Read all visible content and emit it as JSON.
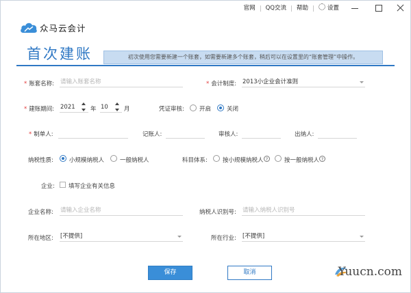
{
  "titlebar": {
    "links": [
      "官网",
      "QQ交流",
      "帮助",
      "设置"
    ]
  },
  "logo": {
    "name": "众马云会计"
  },
  "page": {
    "title": "首次建账",
    "info": "初次使用您需要新建一个账套，如需要新建多个账套，稍后可以在设置里的“账套管理”中操作。"
  },
  "form": {
    "account_name": {
      "label": "账套名称:",
      "placeholder": "请输入账套名称"
    },
    "accounting_system": {
      "label": "会计制度:",
      "value": "2013小企业会计准则"
    },
    "period": {
      "label": "建账期间:",
      "year": "2021",
      "year_unit": "年",
      "month": "10",
      "month_unit": "月"
    },
    "voucher_review": {
      "label": "凭证审核:",
      "options": [
        "开启",
        "关闭"
      ],
      "selected": "关闭"
    },
    "maker": {
      "label": "制单人:"
    },
    "bookkeeper": {
      "label": "记账人:"
    },
    "reviewer": {
      "label": "审核人:"
    },
    "cashier": {
      "label": "出纳人:"
    },
    "tax_nature": {
      "label": "纳税性质:",
      "options": [
        "小规模纳税人",
        "一般纳税人"
      ],
      "selected": "小规模纳税人"
    },
    "subject_system": {
      "label": "科目体系:",
      "options": [
        "按小规模纳税人",
        "按一般纳税人"
      ],
      "selected": ""
    },
    "company": {
      "label": "企业:",
      "checkbox_label": "填写企业有关信息",
      "checked": false
    },
    "company_name": {
      "label": "企业名称:",
      "placeholder": "请输入企业名称"
    },
    "taxpayer_id": {
      "label": "纳税人识别号:",
      "placeholder": "请输入纳税人识别号"
    },
    "region": {
      "label": "所在地区:",
      "value": "[不提供]"
    },
    "industry": {
      "label": "所在行业:",
      "value": "[不提供]"
    }
  },
  "buttons": {
    "save": "保存",
    "cancel": "取消"
  },
  "watermark": {
    "text": "Yuucn.com"
  },
  "colors": {
    "accent": "#2f78c4",
    "info_bg": "#c8dcf1",
    "required": "#e23a3a"
  }
}
